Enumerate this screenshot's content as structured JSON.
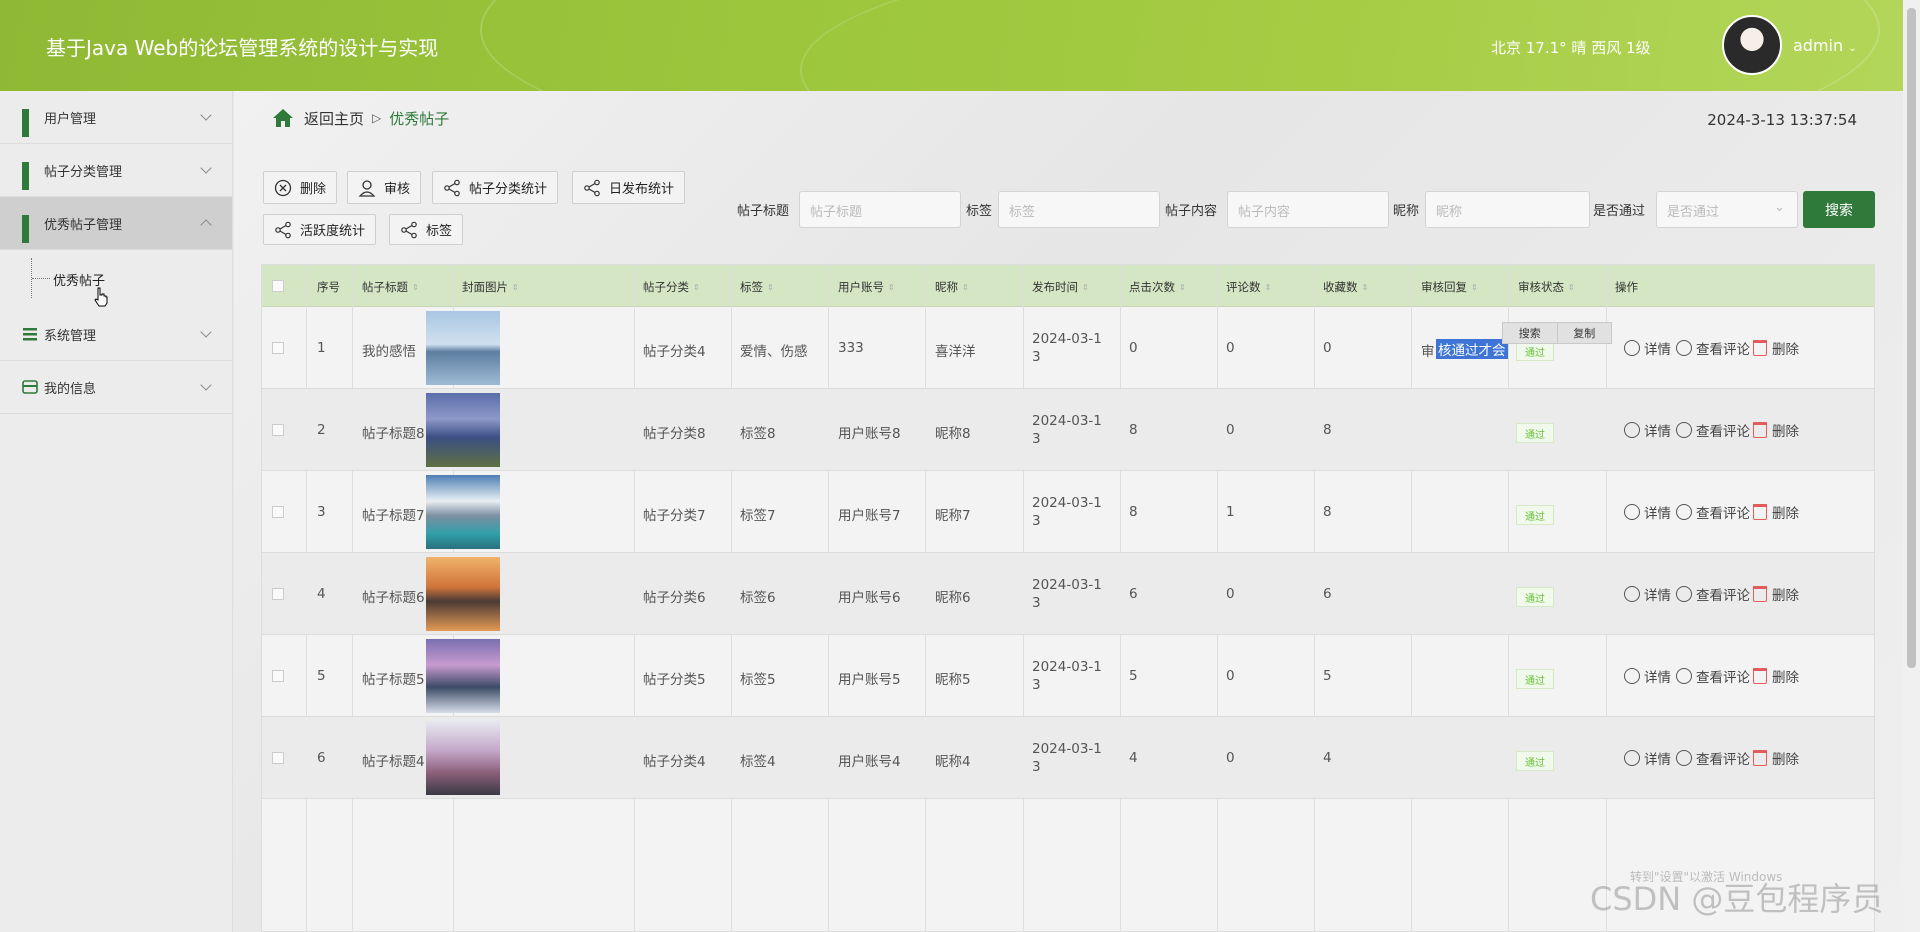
{
  "header": {
    "title": "基于Java Web的论坛管理系统的设计与实现",
    "weather": "北京  17.1°  晴  西风  1级",
    "user": "admin"
  },
  "sidebar": {
    "items": [
      {
        "label": "用户管理",
        "icon": "grid-icon"
      },
      {
        "label": "帖子分类管理",
        "icon": "grid-icon"
      },
      {
        "label": "优秀帖子管理",
        "icon": "grid-icon"
      },
      {
        "label": "系统管理",
        "icon": "list-icon"
      },
      {
        "label": "我的信息",
        "icon": "card-icon"
      }
    ],
    "sub_items": [
      {
        "label": "优秀帖子"
      }
    ]
  },
  "breadcrumb": {
    "home": "返回主页",
    "current": "优秀帖子"
  },
  "datetime": "2024-3-13 13:37:54",
  "toolbar": {
    "delete": "删除",
    "audit": "审核",
    "category_stats": "帖子分类统计",
    "daily_stats": "日发布统计",
    "activity_stats": "活跃度统计",
    "tags": "标签"
  },
  "search": {
    "title_label": "帖子标题",
    "title_placeholder": "帖子标题",
    "tag_label": "标签",
    "tag_placeholder": "标签",
    "content_label": "帖子内容",
    "content_placeholder": "帖子内容",
    "nickname_label": "昵称",
    "nickname_placeholder": "昵称",
    "passed_label": "是否通过",
    "passed_placeholder": "是否通过",
    "button": "搜索"
  },
  "table": {
    "headers": [
      "序号",
      "帖子标题",
      "封面图片",
      "帖子分类",
      "标签",
      "用户账号",
      "昵称",
      "发布时间",
      "点击次数",
      "评论数",
      "收藏数",
      "审核回复",
      "审核状态",
      "操作"
    ],
    "rows": [
      {
        "no": "1",
        "title": "我的感悟",
        "category": "帖子分类4",
        "tag": "爱情、伤感",
        "account": "333",
        "nickname": "喜洋洋",
        "time1": "2024-03-1",
        "time2": "3",
        "clicks": "0",
        "comments": "0",
        "favorites": "0",
        "reply_prefix": "审",
        "reply_selected": "核通过才会",
        "status": "通过"
      },
      {
        "no": "2",
        "title": "帖子标题8",
        "category": "帖子分类8",
        "tag": "标签8",
        "account": "用户账号8",
        "nickname": "昵称8",
        "time1": "2024-03-1",
        "time2": "3",
        "clicks": "8",
        "comments": "0",
        "favorites": "8",
        "reply_prefix": "",
        "reply_selected": "",
        "status": "通过"
      },
      {
        "no": "3",
        "title": "帖子标题7",
        "category": "帖子分类7",
        "tag": "标签7",
        "account": "用户账号7",
        "nickname": "昵称7",
        "time1": "2024-03-1",
        "time2": "3",
        "clicks": "8",
        "comments": "1",
        "favorites": "8",
        "reply_prefix": "",
        "reply_selected": "",
        "status": "通过"
      },
      {
        "no": "4",
        "title": "帖子标题6",
        "category": "帖子分类6",
        "tag": "标签6",
        "account": "用户账号6",
        "nickname": "昵称6",
        "time1": "2024-03-1",
        "time2": "3",
        "clicks": "6",
        "comments": "0",
        "favorites": "6",
        "reply_prefix": "",
        "reply_selected": "",
        "status": "通过"
      },
      {
        "no": "5",
        "title": "帖子标题5",
        "category": "帖子分类5",
        "tag": "标签5",
        "account": "用户账号5",
        "nickname": "昵称5",
        "time1": "2024-03-1",
        "time2": "3",
        "clicks": "5",
        "comments": "0",
        "favorites": "5",
        "reply_prefix": "",
        "reply_selected": "",
        "status": "通过"
      },
      {
        "no": "6",
        "title": "帖子标题4",
        "category": "帖子分类4",
        "tag": "标签4",
        "account": "用户账号4",
        "nickname": "昵称4",
        "time1": "2024-03-1",
        "time2": "3",
        "clicks": "4",
        "comments": "0",
        "favorites": "4",
        "reply_prefix": "",
        "reply_selected": "",
        "status": "通过"
      }
    ],
    "ops": {
      "detail": "详情",
      "view_comments": "查看评论",
      "delete": "删除"
    }
  },
  "context_popup": {
    "search": "搜索",
    "copy": "复制"
  },
  "watermark": {
    "main": "CSDN @豆包程序员",
    "activate": "转到\"设置\"以激活 Windows"
  },
  "colors": {
    "accent": "#2f7a3b",
    "header": "#9cc63c",
    "table_head": "#d5e6c4",
    "status": "#67c23a",
    "danger": "#e45b5b"
  }
}
